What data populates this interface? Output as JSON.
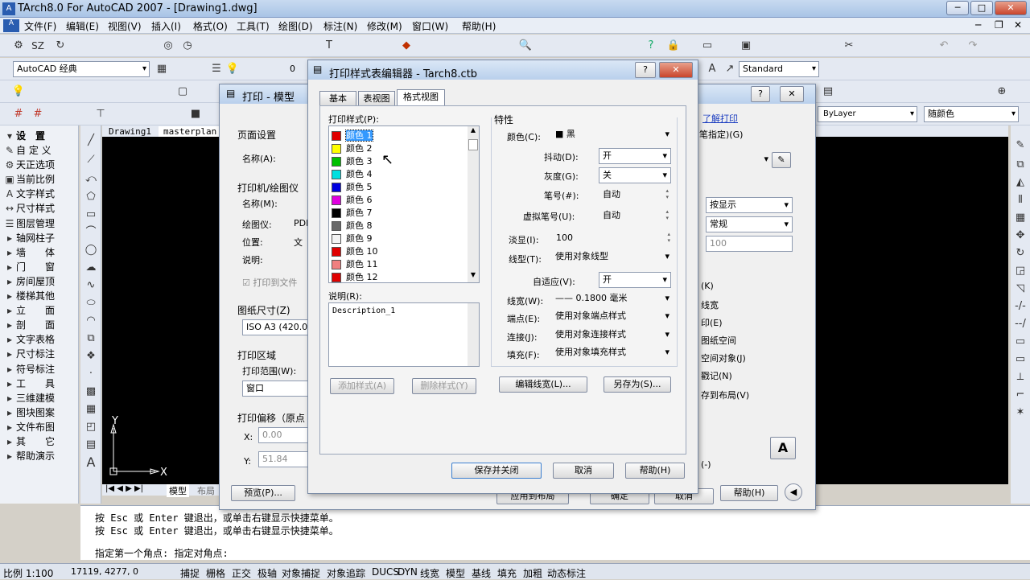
{
  "app": {
    "title": "TArch8.0 For AutoCAD 2007 - [Drawing1.dwg]",
    "icon": "tarch-app-icon"
  },
  "menu": [
    "文件(F)",
    "编辑(E)",
    "视图(V)",
    "插入(I)",
    "格式(O)",
    "工具(T)",
    "绘图(D)",
    "标注(N)",
    "修改(M)",
    "窗口(W)",
    "帮助(H)"
  ],
  "toolbar": {
    "workspace": "AutoCAD 经典",
    "layer_value": "0",
    "text_style": "Standard",
    "linetype": "ByLayer",
    "color": "随颜色",
    "tb1_label": "SZ"
  },
  "left_panel": {
    "header": "设　置",
    "items": [
      {
        "icon": "pencil",
        "label": "自 定 义"
      },
      {
        "icon": "gear",
        "label": "天正选项"
      },
      {
        "icon": "ratio",
        "label": "当前比例"
      },
      {
        "icon": "text",
        "label": "文字样式"
      },
      {
        "icon": "dim",
        "label": "尺寸样式"
      },
      {
        "icon": "layers",
        "label": "图层管理"
      },
      {
        "icon": "arrow",
        "label": "轴网柱子"
      },
      {
        "icon": "arrow",
        "label": "墙　　体"
      },
      {
        "icon": "arrow",
        "label": "门　　窗"
      },
      {
        "icon": "arrow",
        "label": "房间屋顶"
      },
      {
        "icon": "arrow",
        "label": "楼梯其他"
      },
      {
        "icon": "arrow",
        "label": "立　　面"
      },
      {
        "icon": "arrow",
        "label": "剖　　面"
      },
      {
        "icon": "arrow",
        "label": "文字表格"
      },
      {
        "icon": "arrow",
        "label": "尺寸标注"
      },
      {
        "icon": "arrow",
        "label": "符号标注"
      },
      {
        "icon": "arrow",
        "label": "工　　具"
      },
      {
        "icon": "arrow",
        "label": "三维建模"
      },
      {
        "icon": "arrow",
        "label": "图块图案"
      },
      {
        "icon": "arrow",
        "label": "文件布图"
      },
      {
        "icon": "arrow",
        "label": "其　　它"
      },
      {
        "icon": "arrow",
        "label": "帮助演示"
      }
    ]
  },
  "drawing_tabs": [
    "Drawing1",
    "masterplan"
  ],
  "layout_tabs": [
    "模型",
    "布局"
  ],
  "ucs": {
    "x": "X",
    "y": "Y"
  },
  "command": {
    "lines": [
      "按 Esc 或 Enter 键退出，或单击右键显示快捷菜单。",
      "按 Esc 或 Enter 键退出，或单击右键显示快捷菜单。"
    ],
    "prompt": "指定第一个角点: 指定对角点:"
  },
  "status": {
    "scale": "比例 1:100",
    "coords": "17119, 4277, 0",
    "toggles": [
      "捕捉",
      "栅格",
      "正交",
      "极轴",
      "对象捕捉",
      "对象追踪",
      "DUCS",
      "DYN",
      "线宽",
      "模型",
      "基线",
      "填充",
      "加粗",
      "动态标注"
    ]
  },
  "plot_dialog": {
    "title": "打印 - 模型",
    "page_setup": "页面设置",
    "name_label": "名称(A):",
    "printer_group": "打印机/绘图仪",
    "printer_name": "名称(M):",
    "plotter_label": "绘图仪:",
    "plotter_value": "PDF",
    "location_label": "位置:",
    "location_value": "文",
    "desc_label": "说明:",
    "print_to_file": "打印到文件",
    "paper_size_label": "图纸尺寸(Z)",
    "paper_size": "ISO A3 (420.0",
    "plot_area": "打印区域",
    "plot_range": "打印范围(W):",
    "plot_range_value": "窗口",
    "offset": "打印偏移（原点",
    "x_label": "X:",
    "x_value": "0.00",
    "y_label": "Y:",
    "y_value": "51.84",
    "preview": "预览(P)...",
    "help": "帮助(H)",
    "learn": "了解打印",
    "style_table": "笔指定)(G)",
    "shade": "按显示",
    "quality": "常规",
    "dpi": "100",
    "r_items": [
      "(K)",
      "线宽",
      "印(E)",
      "图纸空间",
      "空间对象(J)",
      "戳记(N)",
      "存到布局(V)"
    ],
    "r_last": "(-)",
    "apply": "应用到布局",
    "ok": "确定",
    "cancel": "取消"
  },
  "editor": {
    "title": "打印样式表编辑器 - Tarch8.ctb",
    "tabs": [
      "基本",
      "表视图",
      "格式视图"
    ],
    "styles_label": "打印样式(P):",
    "styles": [
      {
        "name": "颜色 1",
        "color": "#e00000"
      },
      {
        "name": "颜色 2",
        "color": "#ffff00"
      },
      {
        "name": "颜色 3",
        "color": "#00c000"
      },
      {
        "name": "颜色 4",
        "color": "#00e0e0"
      },
      {
        "name": "颜色 5",
        "color": "#0000e0"
      },
      {
        "name": "颜色 6",
        "color": "#e000e0"
      },
      {
        "name": "颜色 7",
        "color": "#000000"
      },
      {
        "name": "颜色 8",
        "color": "#6a6a6a"
      },
      {
        "name": "颜色 9",
        "color": "#f4f4f4"
      },
      {
        "name": "颜色 10",
        "color": "#e00000"
      },
      {
        "name": "颜色 11",
        "color": "#f08080"
      },
      {
        "name": "颜色 12",
        "color": "#e00000"
      }
    ],
    "desc_label": "说明(R):",
    "desc_value": "Description_1",
    "add_style": "添加样式(A)",
    "delete_style": "删除样式(Y)",
    "props_label": "特性",
    "props": {
      "color_label": "颜色(C):",
      "color_value": "■ 黑",
      "dither_label": "抖动(D):",
      "dither_value": "开",
      "gray_label": "灰度(G):",
      "gray_value": "关",
      "pen_label": "笔号(#):",
      "pen_value": "自动",
      "vpen_label": "虚拟笔号(U):",
      "vpen_value": "自动",
      "screen_label": "淡显(I):",
      "screen_value": "100",
      "linetype_label": "线型(T):",
      "linetype_value": "使用对象线型",
      "adaptive_label": "自适应(V):",
      "adaptive_value": "开",
      "lineweight_label": "线宽(W):",
      "lineweight_value": "—— 0.1800 毫米",
      "endstyle_label": "端点(E):",
      "endstyle_value": "使用对象端点样式",
      "join_label": "连接(J):",
      "join_value": "使用对象连接样式",
      "fill_label": "填充(F):",
      "fill_value": "使用对象填充样式"
    },
    "edit_lw": "编辑线宽(L)...",
    "save_as": "另存为(S)...",
    "save_close": "保存并关闭",
    "cancel": "取消",
    "help": "帮助(H)",
    "help_q": "?",
    "close": "✕"
  }
}
